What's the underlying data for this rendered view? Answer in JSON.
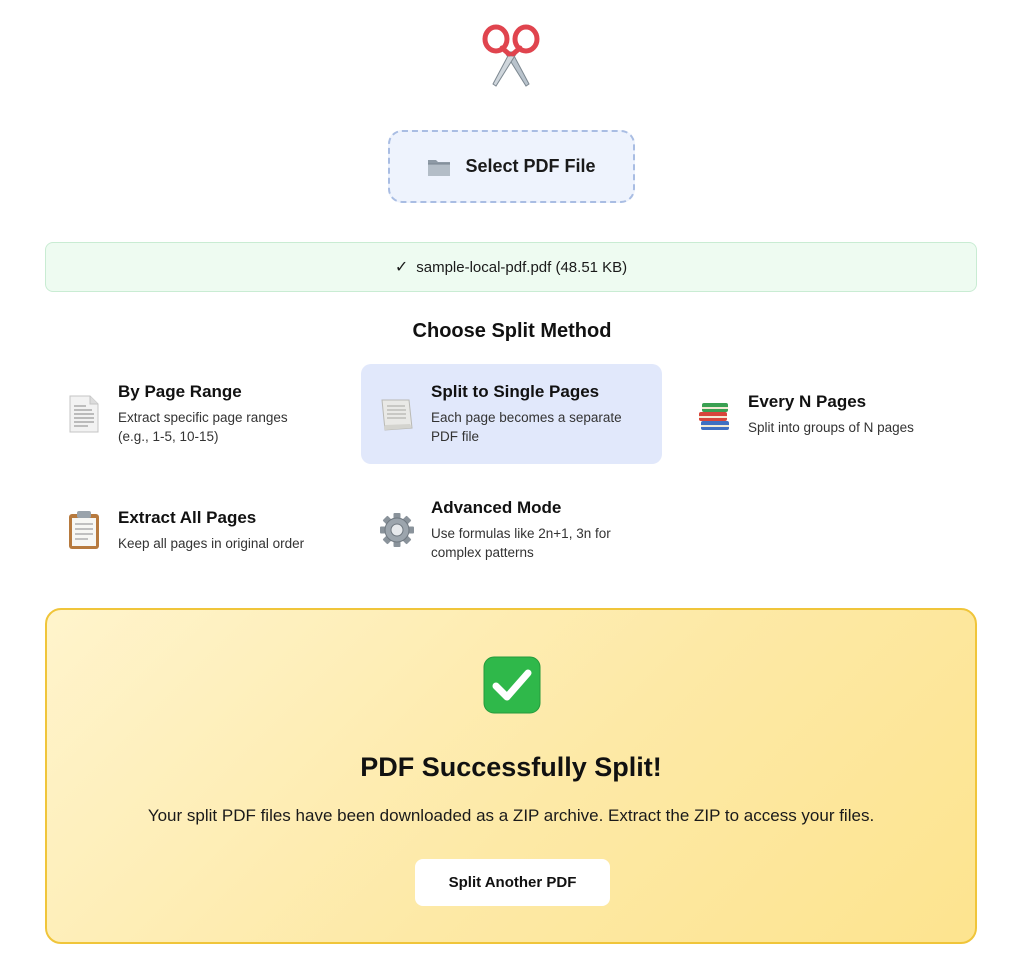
{
  "hero": {
    "icon": "scissors-icon"
  },
  "select_file": {
    "label": "Select PDF File",
    "icon": "folder-icon"
  },
  "file_info": {
    "check": "✓",
    "filename": "sample-local-pdf.pdf (48.51 KB)"
  },
  "split_method": {
    "title": "Choose Split Method",
    "options": [
      {
        "title": "By Page Range",
        "desc1": "Extract specific page ranges",
        "desc2": "(e.g., 1-5, 10-15)",
        "icon": "page-range-icon",
        "selected": false
      },
      {
        "title": "Split to Single Pages",
        "desc1": "Each page becomes a separate",
        "desc2": "PDF file",
        "icon": "single-page-icon",
        "selected": true
      },
      {
        "title": "Every N Pages",
        "desc1": "Split into groups of N pages",
        "desc2": "",
        "icon": "books-icon",
        "selected": false
      },
      {
        "title": "Extract All Pages",
        "desc1": "Keep all pages in original order",
        "desc2": "",
        "icon": "clipboard-icon",
        "selected": false
      },
      {
        "title": "Advanced Mode",
        "desc1": "Use formulas like 2n+1, 3n for",
        "desc2": "complex patterns",
        "icon": "gear-icon",
        "selected": false
      }
    ]
  },
  "success": {
    "icon": "checkmark-icon",
    "title": "PDF Successfully Split!",
    "message": "Your split PDF files have been downloaded as a ZIP archive. Extract the ZIP to access your files.",
    "button_label": "Split Another PDF"
  },
  "colors": {
    "accent_selected": "#e1e8fb",
    "success_border": "#f0c53a",
    "file_bar_bg": "#eefbf1",
    "check_green": "#2fb84a"
  }
}
